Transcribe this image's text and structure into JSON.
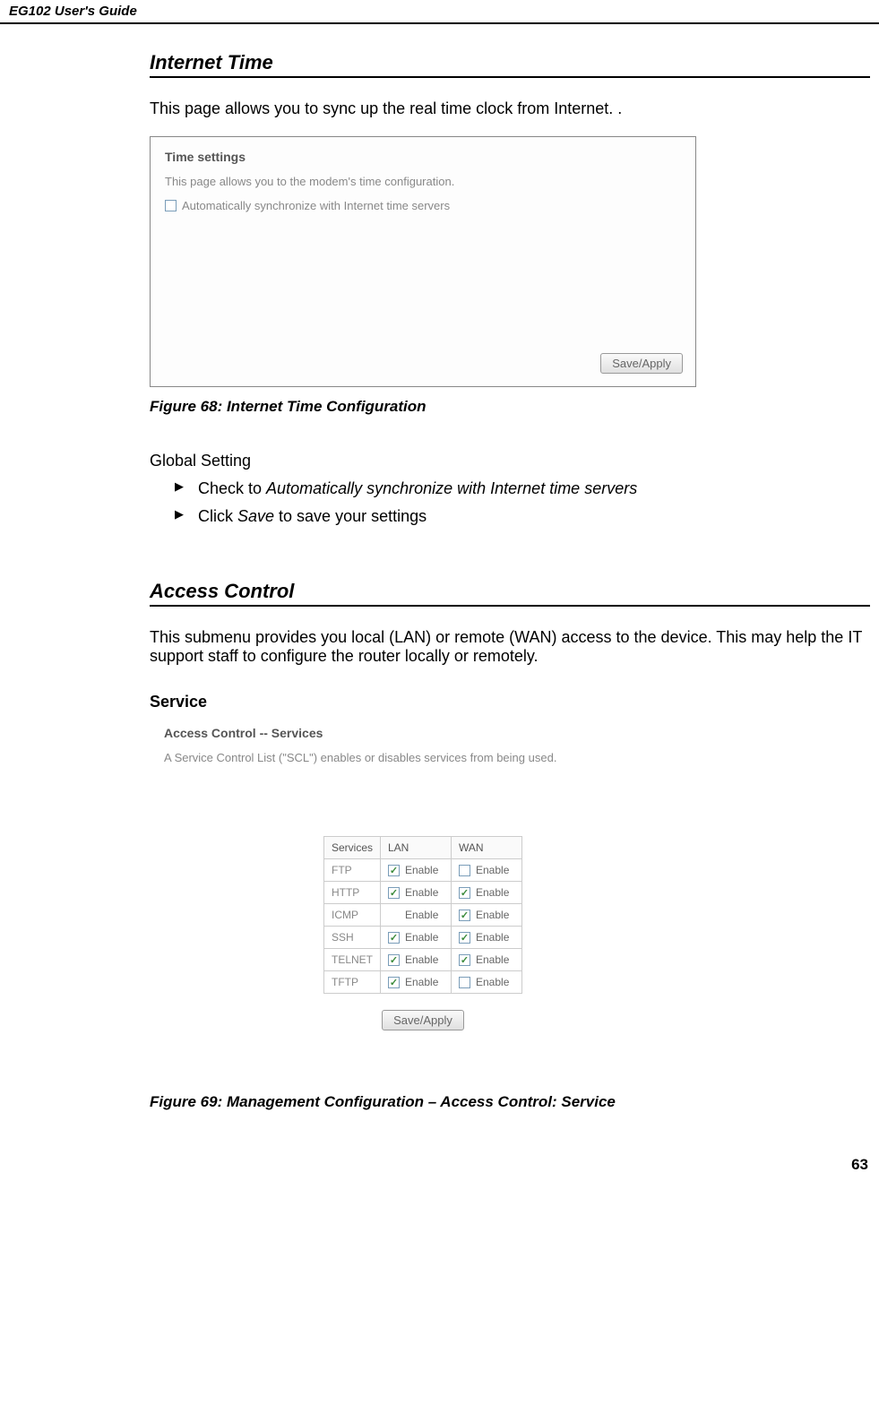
{
  "header": {
    "title": "EG102 User's Guide"
  },
  "section1": {
    "title": "Internet Time",
    "intro": "This page allows you to sync up the real time clock from Internet. .",
    "screenshot": {
      "title": "Time settings",
      "description": "This page allows you to the modem's time configuration.",
      "checkbox_label": "Automatically synchronize with Internet time servers",
      "save_btn": "Save/Apply"
    },
    "figure_caption": "Figure 68: Internet Time Configuration",
    "global_setting_label": "Global Setting",
    "bullets": [
      {
        "prefix": "Check to ",
        "italic": "Automatically synchronize with Internet time servers",
        "suffix": ""
      },
      {
        "prefix": "Click ",
        "italic": "Save",
        "suffix": " to save your settings"
      }
    ]
  },
  "section2": {
    "title": "Access Control",
    "intro": "This submenu provides you local (LAN) or remote (WAN) access to the device. This may help the IT support staff to configure the router locally or remotely.",
    "service_label": "Service",
    "screenshot": {
      "title": "Access Control -- Services",
      "description": "A Service Control List (\"SCL\") enables or disables services from being used.",
      "headers": {
        "c1": "Services",
        "c2": "LAN",
        "c3": "WAN"
      },
      "enable_label": "Enable",
      "rows": [
        {
          "name": "FTP",
          "lan_checked": true,
          "lan_has_cb": true,
          "wan_checked": false,
          "wan_has_cb": true
        },
        {
          "name": "HTTP",
          "lan_checked": true,
          "lan_has_cb": true,
          "wan_checked": true,
          "wan_has_cb": true
        },
        {
          "name": "ICMP",
          "lan_checked": false,
          "lan_has_cb": false,
          "wan_checked": true,
          "wan_has_cb": true
        },
        {
          "name": "SSH",
          "lan_checked": true,
          "lan_has_cb": true,
          "wan_checked": true,
          "wan_has_cb": true
        },
        {
          "name": "TELNET",
          "lan_checked": true,
          "lan_has_cb": true,
          "wan_checked": true,
          "wan_has_cb": true
        },
        {
          "name": "TFTP",
          "lan_checked": true,
          "lan_has_cb": true,
          "wan_checked": false,
          "wan_has_cb": true
        }
      ],
      "save_btn": "Save/Apply"
    },
    "figure_caption": "Figure 69: Management Configuration – Access Control: Service"
  },
  "page_number": "63"
}
